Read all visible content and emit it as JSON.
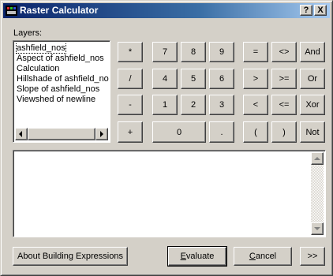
{
  "window": {
    "title": "Raster Calculator",
    "help_glyph": "?",
    "close_glyph": "X"
  },
  "layers": {
    "label": "Layers:",
    "items": [
      "ashfield_nos",
      "Aspect of ashfield_nos",
      "Calculation",
      "Hillshade of ashfield_nos",
      "Slope of ashfield_nos",
      "Viewshed of newline"
    ],
    "selected_index": 0
  },
  "keypad": {
    "multiply": "*",
    "divide": "/",
    "subtract": "-",
    "add": "+",
    "n7": "7",
    "n8": "8",
    "n9": "9",
    "n4": "4",
    "n5": "5",
    "n6": "6",
    "n1": "1",
    "n2": "2",
    "n3": "3",
    "n0": "0",
    "decimal": "."
  },
  "operators": {
    "equal": "=",
    "not_equal": "<>",
    "and": "And",
    "greater": ">",
    "greater_equal": ">=",
    "or": "Or",
    "less": "<",
    "less_equal": "<=",
    "xor": "Xor",
    "open_paren": "(",
    "close_paren": ")",
    "not": "Not"
  },
  "expression": {
    "value": ""
  },
  "footer": {
    "about": "About Building Expressions",
    "evaluate_mnemonic": "E",
    "evaluate_rest": "valuate",
    "cancel_mnemonic": "C",
    "cancel_rest": "ancel",
    "more": ">>"
  }
}
